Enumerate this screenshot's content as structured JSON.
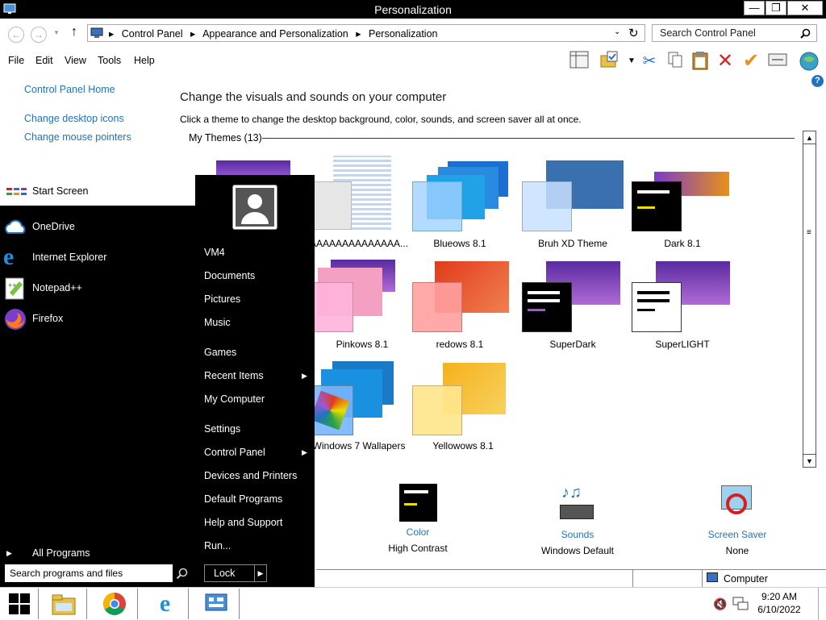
{
  "window": {
    "title": "Personalization",
    "minimize": "—",
    "restore": "❐",
    "close": "✕"
  },
  "address": {
    "crumbs": [
      "Control Panel",
      "Appearance and Personalization",
      "Personalization"
    ],
    "separator": "▸"
  },
  "search": {
    "placeholder": "Search Control Panel"
  },
  "menu": [
    "File",
    "Edit",
    "View",
    "Tools",
    "Help"
  ],
  "left_links": [
    "Control Panel Home",
    "Change desktop icons",
    "Change mouse pointers"
  ],
  "main": {
    "title": "Change the visuals and sounds on your computer",
    "subtitle": "Click a theme to change the desktop background, color, sounds, and screen saver all at once.",
    "section": "My Themes (13)"
  },
  "themes": [
    {
      "label": "AAAAAAAAAAAAAA..."
    },
    {
      "label": "Blueows 8.1"
    },
    {
      "label": "Bruh XD Theme"
    },
    {
      "label": "Dark 8.1"
    },
    {
      "label": "Pinkows 8.1"
    },
    {
      "label": "redows 8.1"
    },
    {
      "label": "SuperDark"
    },
    {
      "label": "SuperLIGHT"
    },
    {
      "label": "Windows 7 Wallapers"
    },
    {
      "label": "Yellowows 8.1"
    }
  ],
  "bottom": [
    {
      "link": "Color",
      "value": "High Contrast"
    },
    {
      "link": "Sounds",
      "value": "Windows Default"
    },
    {
      "link": "Screen Saver",
      "value": "None"
    }
  ],
  "status": {
    "computer": "Computer"
  },
  "start_menu": {
    "start_screen": "Start Screen",
    "pinned": [
      "OneDrive",
      "Internet Explorer",
      "Notepad++",
      "Firefox"
    ],
    "all_programs": "All Programs",
    "search_placeholder": "Search programs and files",
    "right": [
      "VM4",
      "Documents",
      "Pictures",
      "Music",
      "Games",
      "Recent Items",
      "My Computer",
      "Settings",
      "Control Panel",
      "Devices and Printers",
      "Default Programs",
      "Help and Support",
      "Run..."
    ],
    "lock": "Lock"
  },
  "tray": {
    "time": "9:20 AM",
    "date": "6/10/2022"
  },
  "colors": {
    "link": "#1e73be",
    "purple": "#7a3cc9",
    "blue": "#2a6fd1"
  }
}
